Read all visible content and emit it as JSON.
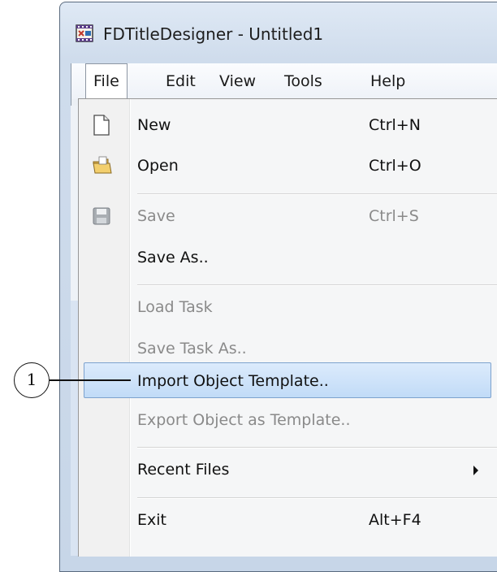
{
  "window": {
    "title": "FDTitleDesigner - Untitled1",
    "app_icon": "film-strip-icon"
  },
  "menubar": {
    "items": [
      "File",
      "Edit",
      "View",
      "Tools",
      "Help"
    ],
    "active": "File"
  },
  "file_menu": {
    "items": [
      {
        "label": "New",
        "shortcut": "Ctrl+N",
        "icon": "new-document-icon",
        "enabled": true
      },
      {
        "label": "Open",
        "shortcut": "Ctrl+O",
        "icon": "open-folder-icon",
        "enabled": true
      },
      {
        "label": "Save",
        "shortcut": "Ctrl+S",
        "icon": "save-disk-icon",
        "enabled": false
      },
      {
        "label": "Save As..",
        "shortcut": "",
        "enabled": true
      },
      {
        "label": "Load Task",
        "shortcut": "",
        "enabled": false
      },
      {
        "label": "Save Task As..",
        "shortcut": "",
        "enabled": false
      },
      {
        "label": "Import Object Template..",
        "shortcut": "",
        "enabled": true,
        "highlighted": true
      },
      {
        "label": "Export Object as Template..",
        "shortcut": "",
        "enabled": false
      },
      {
        "label": "Recent Files",
        "shortcut": "",
        "enabled": true,
        "submenu": true
      },
      {
        "label": "Exit",
        "shortcut": "Alt+F4",
        "enabled": true
      }
    ]
  },
  "callout": {
    "number": "1"
  },
  "colors": {
    "highlight_bg": "#c1dbf7",
    "highlight_border": "#7da2ce",
    "disabled_text": "#8a8a8a"
  }
}
